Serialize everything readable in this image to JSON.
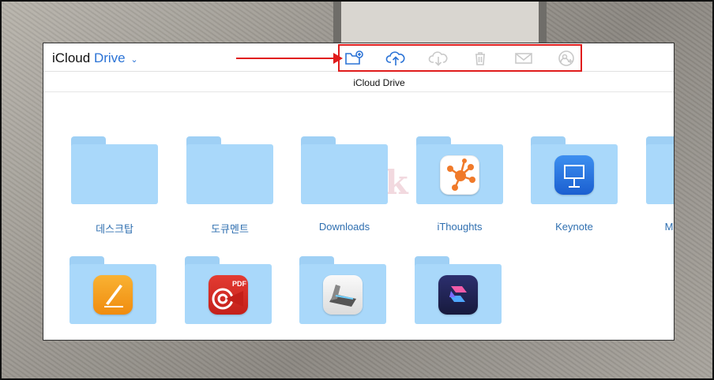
{
  "app": {
    "title_left": "iCloud",
    "title_right": "Drive",
    "chevron": "⌄"
  },
  "path": {
    "title": "iCloud Drive"
  },
  "toolbar": {
    "highlight_color": "#e01c1c",
    "tools": [
      {
        "name": "new-folder-icon",
        "enabled": true
      },
      {
        "name": "upload-icon",
        "enabled": true
      },
      {
        "name": "download-icon",
        "enabled": false
      },
      {
        "name": "trash-icon",
        "enabled": false
      },
      {
        "name": "mail-icon",
        "enabled": false
      },
      {
        "name": "share-user-icon",
        "enabled": false
      }
    ]
  },
  "folders": [
    {
      "label": "데스크탑",
      "app": null
    },
    {
      "label": "도큐멘트",
      "app": null
    },
    {
      "label": "Downloads",
      "app": null
    },
    {
      "label": "iThoughts",
      "app": "ithoughts-icon"
    },
    {
      "label": "Keynote",
      "app": "keynote-icon"
    },
    {
      "label": "M",
      "app": null
    },
    {
      "label": "",
      "app": "pages-icon"
    },
    {
      "label": "",
      "app": "pdf-expert-icon"
    },
    {
      "label": "",
      "app": "scanner-icon"
    },
    {
      "label": "",
      "app": "shortcuts-icon"
    }
  ],
  "watermark": "Book",
  "colors": {
    "accent": "#2b73d6",
    "folder": "#a9d8fa",
    "label": "#2f6fb0"
  }
}
